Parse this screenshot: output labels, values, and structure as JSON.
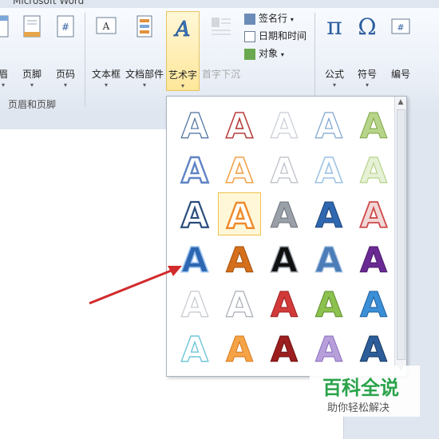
{
  "window": {
    "title": "Microsoft Word"
  },
  "ribbon": {
    "header_footer": {
      "header_label": "眉",
      "footer_label": "页脚",
      "pagenum_label": "页码",
      "group_label": "页眉和页脚"
    },
    "text": {
      "textbox_label": "文本框",
      "quickparts_label": "文档部件",
      "wordart_label": "艺术字",
      "dropcap_label": "首字下沉",
      "signature_label": "签名行",
      "datetime_label": "日期和时间",
      "object_label": "对象"
    },
    "symbols": {
      "equation_label": "公式",
      "symbol_label": "符号",
      "number_label": "编号"
    }
  },
  "wordart_gallery": {
    "items": [
      {
        "style": "outline-blue"
      },
      {
        "style": "red-outline"
      },
      {
        "style": "light-gray"
      },
      {
        "style": "light-blue-outline"
      },
      {
        "style": "green-gradient"
      },
      {
        "style": "blue-glow"
      },
      {
        "style": "orange-outline"
      },
      {
        "style": "gray-outline"
      },
      {
        "style": "sky-outline"
      },
      {
        "style": "light-green"
      },
      {
        "style": "dark-blue"
      },
      {
        "style": "orange-selected"
      },
      {
        "style": "silver"
      },
      {
        "style": "blue-bevel"
      },
      {
        "style": "red-stripe"
      },
      {
        "style": "blue-fill"
      },
      {
        "style": "orange-fill"
      },
      {
        "style": "black-fill"
      },
      {
        "style": "blue-gradient"
      },
      {
        "style": "purple-fill"
      },
      {
        "style": "white-shadow"
      },
      {
        "style": "gray-shadow"
      },
      {
        "style": "red-fill"
      },
      {
        "style": "green-fill"
      },
      {
        "style": "blue-reflect"
      },
      {
        "style": "cyan-outline"
      },
      {
        "style": "orange-soft"
      },
      {
        "style": "dark-red"
      },
      {
        "style": "purple-soft"
      },
      {
        "style": "navy-reflect"
      }
    ],
    "selected_index": 11,
    "letter": "A"
  },
  "watermark": {
    "title": "百科全说",
    "subtitle": "助你轻松解决"
  }
}
